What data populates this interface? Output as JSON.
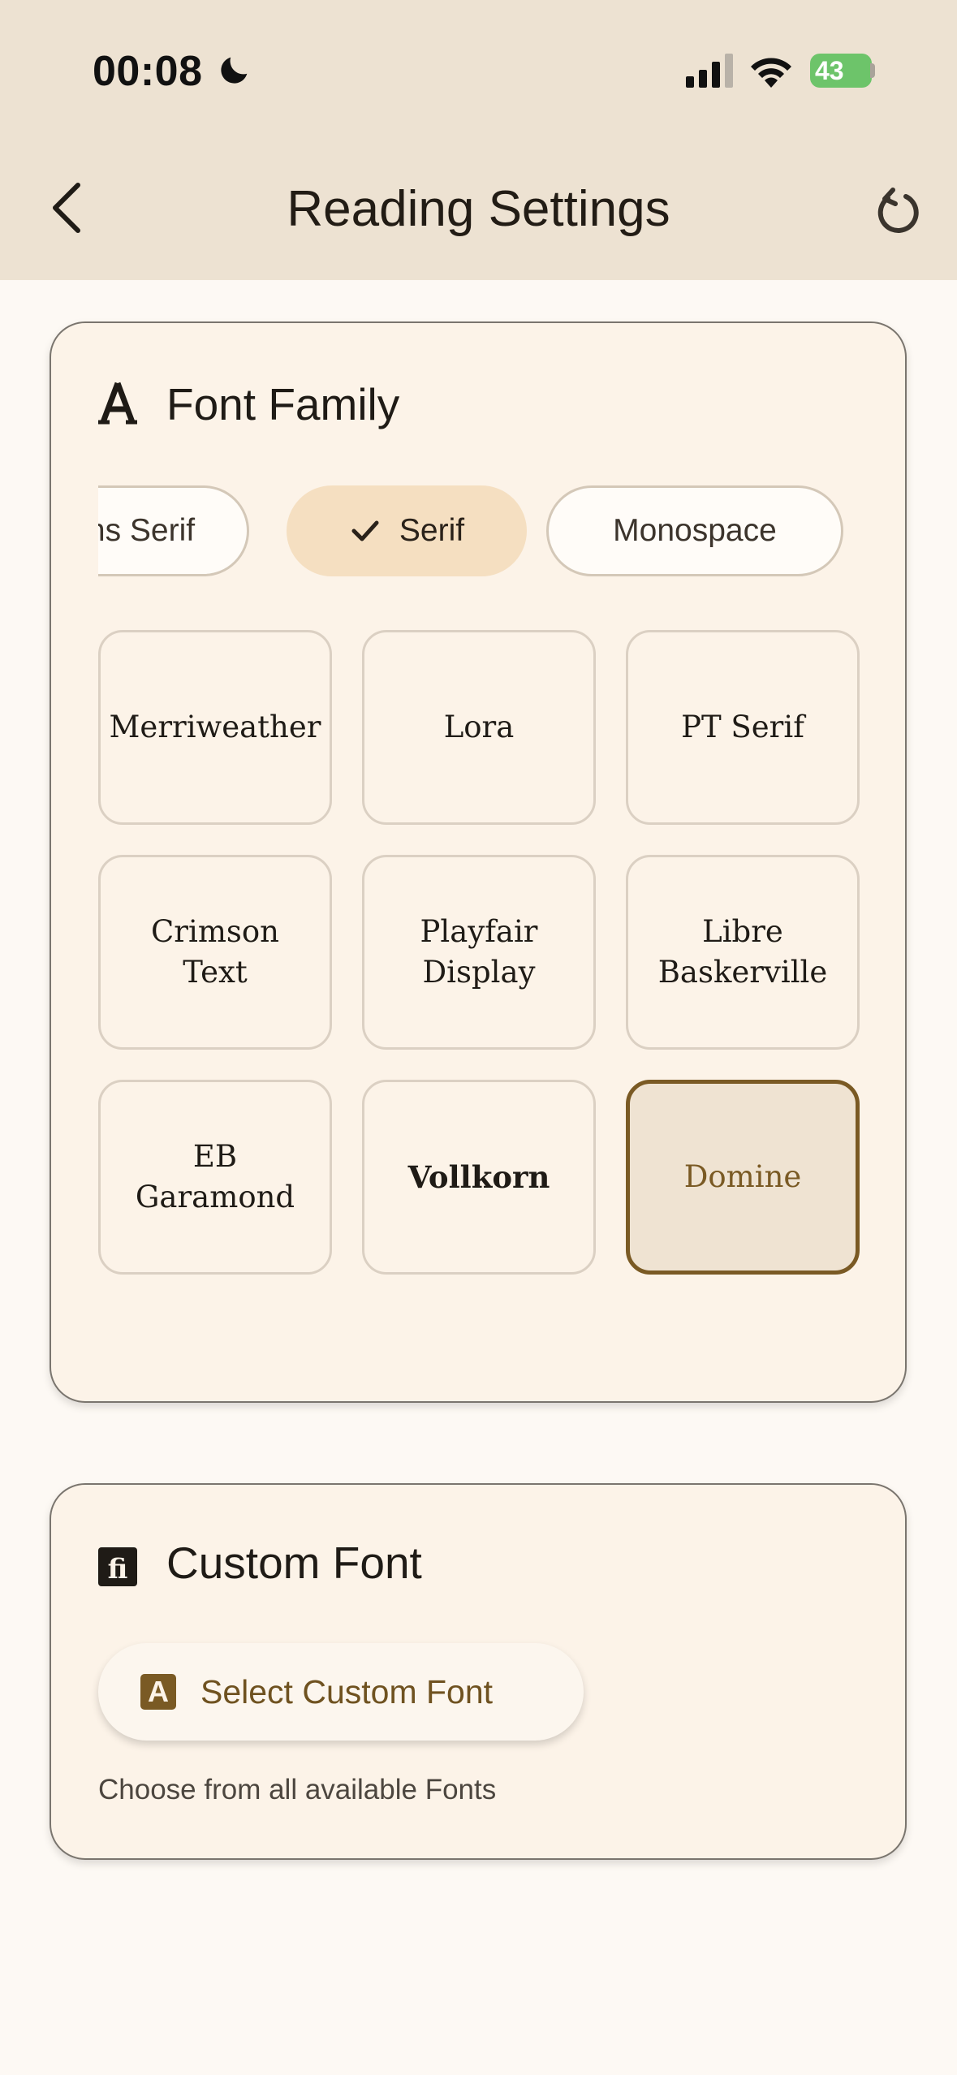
{
  "status_bar": {
    "time": "00:08",
    "battery": "43"
  },
  "app_bar": {
    "title": "Reading Settings"
  },
  "font_family": {
    "title": "Font Family",
    "chips": [
      {
        "label": "ns Serif",
        "selected": false
      },
      {
        "label": "Serif",
        "selected": true
      },
      {
        "label": "Monospace",
        "selected": false
      }
    ],
    "fonts": [
      {
        "name": "Merriweather",
        "selected": false
      },
      {
        "name": "Lora",
        "selected": false
      },
      {
        "name": "PT Serif",
        "selected": false
      },
      {
        "name": "Crimson Text",
        "selected": false
      },
      {
        "name": "Playfair Display",
        "selected": false
      },
      {
        "name": "Libre Baskerville",
        "selected": false
      },
      {
        "name": "EB Garamond",
        "selected": false
      },
      {
        "name": "Vollkorn",
        "selected": false
      },
      {
        "name": "Domine",
        "selected": true
      }
    ]
  },
  "custom_font": {
    "title": "Custom Font",
    "button_label": "Select Custom Font",
    "button_icon_letter": "A",
    "helper": "Choose from all available Fonts"
  },
  "colors": {
    "app_bar": "#ede2d2",
    "card": "#fcf3e8",
    "accent": "#7a5a24",
    "chip_selected": "#f5dfc1",
    "battery": "#6dc46a"
  }
}
